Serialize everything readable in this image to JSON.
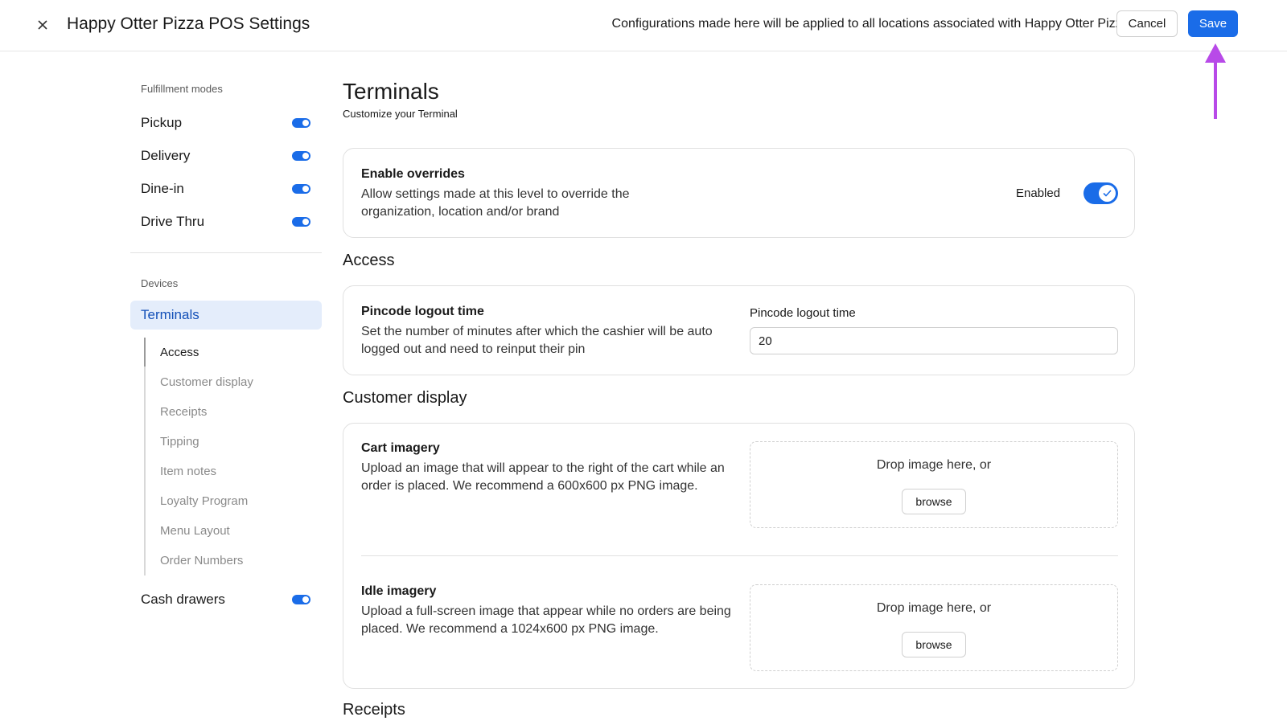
{
  "header": {
    "title": "Happy Otter Pizza POS Settings",
    "notice": "Configurations made here will be applied to all locations associated with Happy Otter Pizza.",
    "cancel_label": "Cancel",
    "save_label": "Save",
    "close_icon": "close-icon",
    "accent_color": "#1a6ce8",
    "annotation_color": "#b84ae8"
  },
  "sidebar": {
    "fulfillment_heading": "Fulfillment modes",
    "fulfillment_items": [
      {
        "label": "Pickup",
        "enabled": true
      },
      {
        "label": "Delivery",
        "enabled": true
      },
      {
        "label": "Dine-in",
        "enabled": true
      },
      {
        "label": "Drive Thru",
        "enabled": true
      }
    ],
    "devices_heading": "Devices",
    "active_item": "Terminals",
    "sub_items": [
      "Access",
      "Customer display",
      "Receipts",
      "Tipping",
      "Item notes",
      "Loyalty Program",
      "Menu Layout",
      "Order Numbers"
    ],
    "cash_drawers": {
      "label": "Cash drawers",
      "enabled": true
    }
  },
  "main": {
    "title": "Terminals",
    "subtitle": "Customize your Terminal",
    "overrides": {
      "title": "Enable overrides",
      "description": "Allow settings made at this level to override the organization, location and/or brand",
      "status_label": "Enabled",
      "enabled": true
    },
    "access": {
      "heading": "Access",
      "title": "Pincode logout time",
      "description": "Set the number of minutes after which the cashier will be auto logged out and need to reinput their pin",
      "field_label": "Pincode logout time",
      "field_value": "20"
    },
    "customer_display": {
      "heading": "Customer display",
      "cart": {
        "title": "Cart imagery",
        "description": "Upload an image that will appear to the right of the cart while an order is placed. We recommend a 600x600 px PNG image.",
        "drop_text": "Drop image here, or",
        "browse_label": "browse"
      },
      "idle": {
        "title": "Idle imagery",
        "description": "Upload a full-screen image that appear while no orders are being placed. We recommend a 1024x600 px PNG image.",
        "drop_text": "Drop image here, or",
        "browse_label": "browse"
      }
    },
    "next_heading": "Receipts"
  }
}
